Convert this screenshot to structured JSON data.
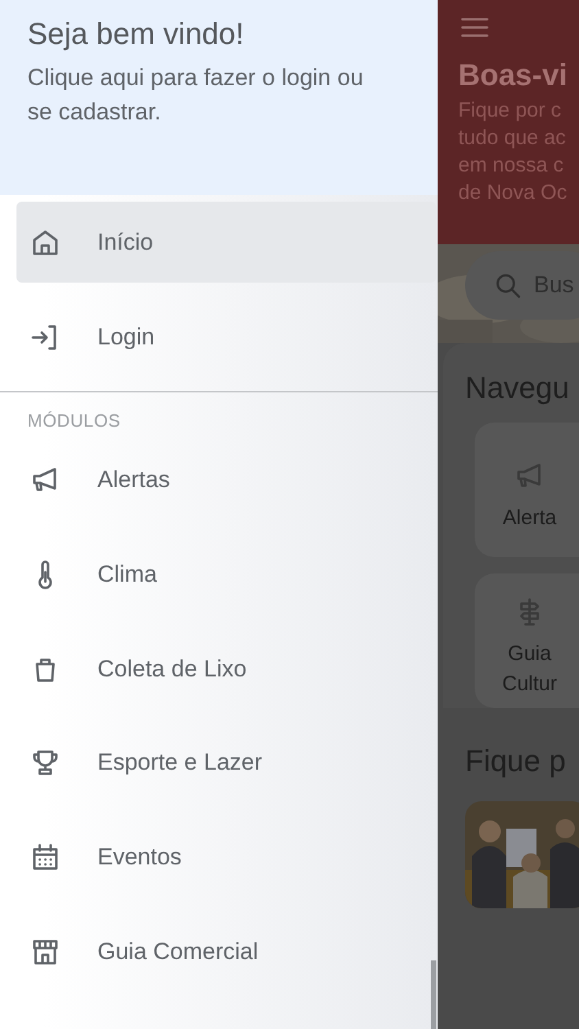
{
  "drawer": {
    "header": {
      "title": "Seja bem vindo!",
      "subtitle": "Clique aqui para fazer o login ou se cadastrar."
    },
    "items": [
      {
        "label": "Início",
        "selected": true
      },
      {
        "label": "Login",
        "selected": false
      }
    ],
    "section_label": "MÓDULOS",
    "modules": [
      {
        "label": "Alertas",
        "selected": false
      },
      {
        "label": "Clima",
        "selected": false
      },
      {
        "label": "Coleta de Lixo",
        "selected": false
      },
      {
        "label": "Esporte e Lazer",
        "selected": false
      },
      {
        "label": "Eventos",
        "selected": false
      },
      {
        "label": "Guia Comercial",
        "selected": false
      }
    ]
  },
  "background": {
    "banner": {
      "title": "Boas-vi",
      "lines": [
        "Fique por c",
        "tudo que ac",
        "em nossa c",
        "de Nova Oc"
      ]
    },
    "search": {
      "placeholder": "Bus"
    },
    "navigate": {
      "title": "Navegu",
      "tiles": [
        {
          "label": "Alerta"
        },
        {
          "label": "Guia Cultur"
        }
      ]
    },
    "news": {
      "title": "Fique p"
    }
  }
}
